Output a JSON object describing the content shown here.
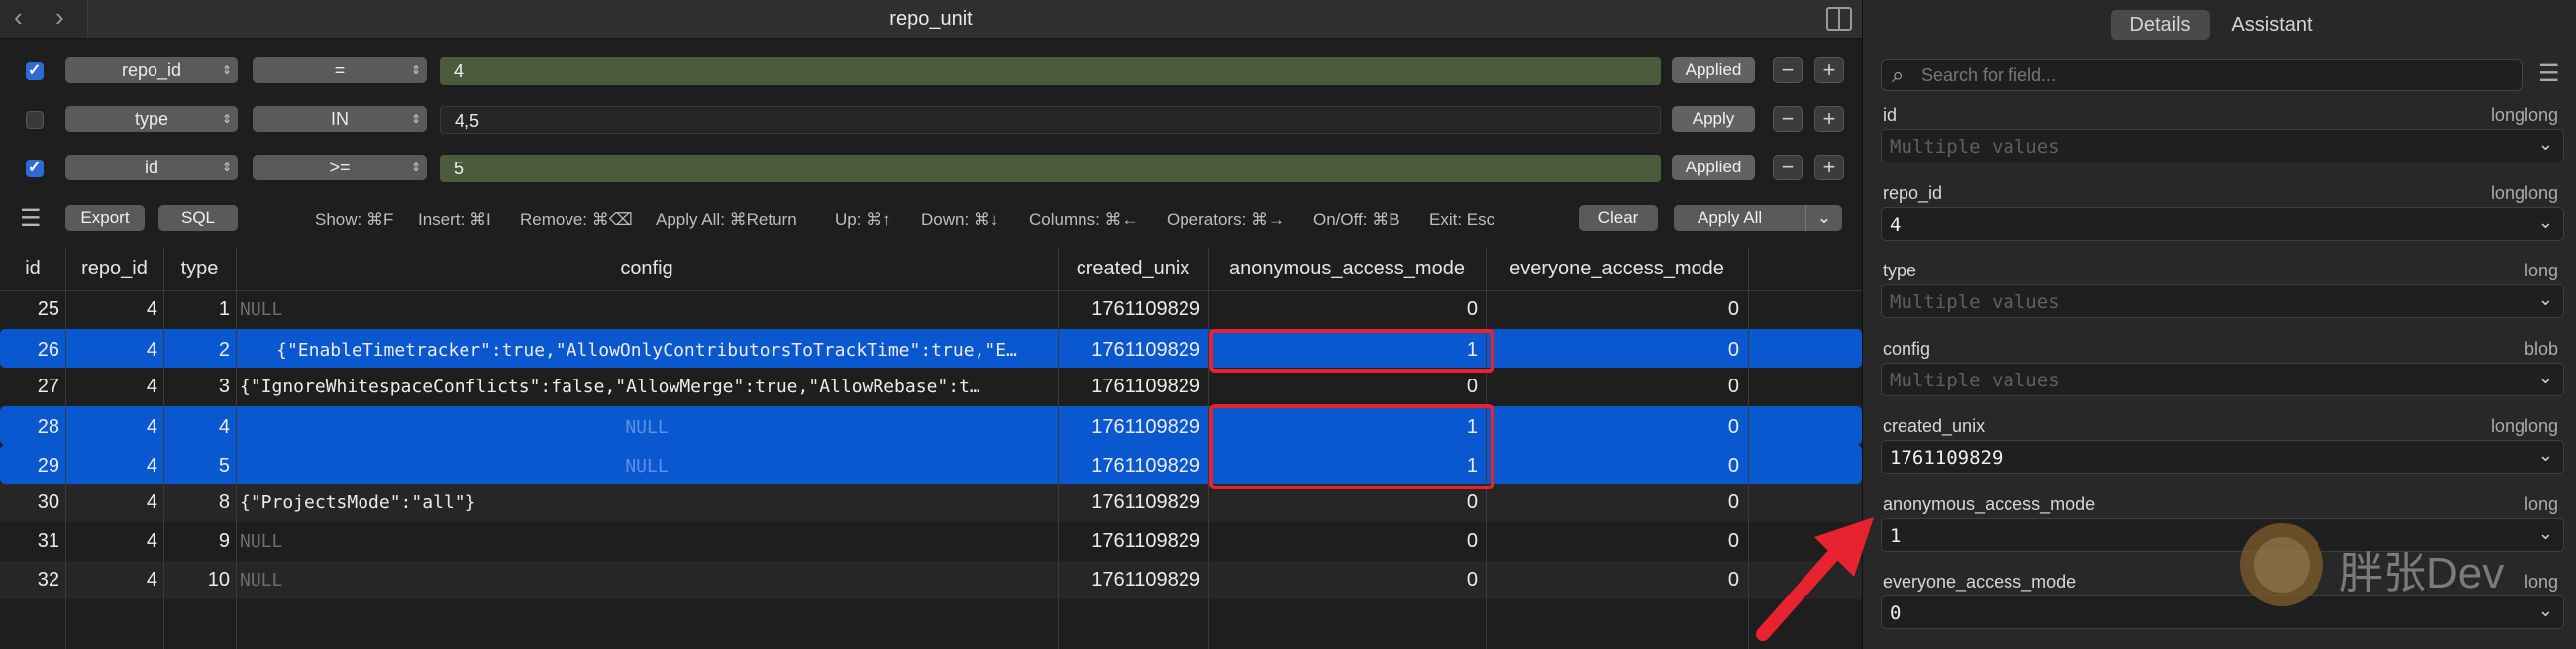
{
  "window": {
    "title": "repo_unit"
  },
  "filters": [
    {
      "enabled": true,
      "column": "repo_id",
      "operator": "=",
      "value": "4",
      "button": "Applied"
    },
    {
      "enabled": false,
      "column": "type",
      "operator": "IN",
      "value": "4,5",
      "button": "Apply"
    },
    {
      "enabled": true,
      "column": "id",
      "operator": ">=",
      "value": "5",
      "button": "Applied"
    }
  ],
  "toolbar": {
    "export_label": "Export",
    "sql_label": "SQL",
    "shortcuts": [
      "Show: ⌘F",
      "Insert: ⌘I",
      "Remove: ⌘⌫",
      "Apply All: ⌘Return",
      "Up: ⌘↑",
      "Down: ⌘↓",
      "Columns: ⌘←",
      "Operators: ⌘→",
      "On/Off: ⌘B",
      "Exit: Esc"
    ],
    "clear_label": "Clear",
    "apply_all_label": "Apply All"
  },
  "grid": {
    "columns": [
      "id",
      "repo_id",
      "type",
      "config",
      "created_unix",
      "anonymous_access_mode",
      "everyone_access_mode"
    ],
    "rows": [
      {
        "id": "25",
        "repo_id": "4",
        "type": "1",
        "config": "NULL",
        "config_null": true,
        "created_unix": "1761109829",
        "anon": "0",
        "everyone": "0",
        "selected": false
      },
      {
        "id": "26",
        "repo_id": "4",
        "type": "2",
        "config": "{\"EnableTimetracker\":true,\"AllowOnlyContributorsToTrackTime\":true,\"E…",
        "config_null": false,
        "created_unix": "1761109829",
        "anon": "1",
        "everyone": "0",
        "selected": true
      },
      {
        "id": "27",
        "repo_id": "4",
        "type": "3",
        "config": "{\"IgnoreWhitespaceConflicts\":false,\"AllowMerge\":true,\"AllowRebase\":t…",
        "config_null": false,
        "created_unix": "1761109829",
        "anon": "0",
        "everyone": "0",
        "selected": false
      },
      {
        "id": "28",
        "repo_id": "4",
        "type": "4",
        "config": "NULL",
        "config_null": true,
        "created_unix": "1761109829",
        "anon": "1",
        "everyone": "0",
        "selected": true
      },
      {
        "id": "29",
        "repo_id": "4",
        "type": "5",
        "config": "NULL",
        "config_null": true,
        "created_unix": "1761109829",
        "anon": "1",
        "everyone": "0",
        "selected": true
      },
      {
        "id": "30",
        "repo_id": "4",
        "type": "8",
        "config": "{\"ProjectsMode\":\"all\"}",
        "config_null": false,
        "created_unix": "1761109829",
        "anon": "0",
        "everyone": "0",
        "selected": false
      },
      {
        "id": "31",
        "repo_id": "4",
        "type": "9",
        "config": "NULL",
        "config_null": true,
        "created_unix": "1761109829",
        "anon": "0",
        "everyone": "0",
        "selected": false
      },
      {
        "id": "32",
        "repo_id": "4",
        "type": "10",
        "config": "NULL",
        "config_null": true,
        "created_unix": "1761109829",
        "anon": "0",
        "everyone": "0",
        "selected": false
      }
    ]
  },
  "inspector": {
    "tabs": [
      "Details",
      "Assistant"
    ],
    "active_tab": "Details",
    "search_placeholder": "Search for field...",
    "fields": [
      {
        "name": "id",
        "type": "longlong",
        "value": "Multiple values",
        "multiple": true
      },
      {
        "name": "repo_id",
        "type": "longlong",
        "value": "4",
        "multiple": false
      },
      {
        "name": "type",
        "type": "long",
        "value": "Multiple values",
        "multiple": true
      },
      {
        "name": "config",
        "type": "blob",
        "value": "Multiple values",
        "multiple": true
      },
      {
        "name": "created_unix",
        "type": "longlong",
        "value": "1761109829",
        "multiple": false
      },
      {
        "name": "anonymous_access_mode",
        "type": "long",
        "value": "1",
        "multiple": false
      },
      {
        "name": "everyone_access_mode",
        "type": "long",
        "value": "0",
        "multiple": false
      }
    ]
  },
  "watermark": {
    "text": "胖张Dev"
  },
  "colors": {
    "selection": "#0a58d0",
    "highlight": "#e8232f",
    "applied_value": "#4c5b3e"
  }
}
